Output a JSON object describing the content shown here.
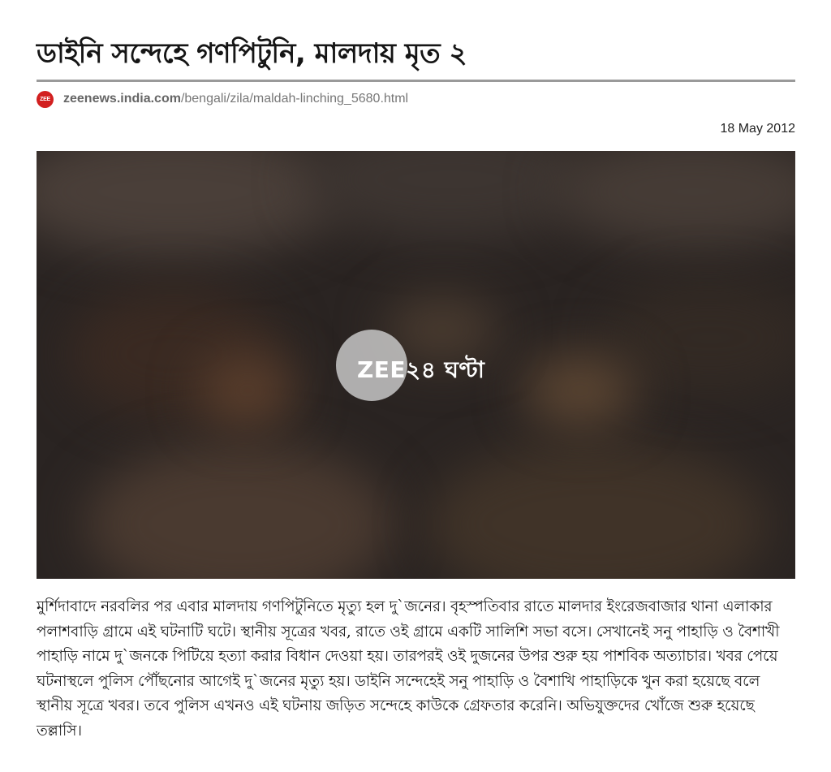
{
  "article": {
    "headline": "ডাইনি সন্দেহে গণপিটুনি, মালদায় মৃত ২",
    "source": {
      "favicon_text": "ZEE",
      "domain": "zeenews.india.com",
      "path": "/bengali/zila/maldah-linching_5680.html"
    },
    "date": "18 May 2012",
    "media": {
      "logo_text": "ZEE২৪ ঘণ্টা",
      "colors": {
        "background": "#2a2422",
        "logo_circle": "#cdcdcd"
      }
    },
    "body": "মুর্শিদাবাদে নরবলির পর এবার মালদায় গণপিটুনিতে মৃত্যু হল দু`জনের। বৃহস্পতিবার রাতে মালদার ইংরেজবাজার থানা এলাকার পলাশবাড়ি গ্রামে এই ঘটনাটি ঘটে। স্থানীয় সূত্রের খবর, রাতে ওই গ্রামে একটি সালিশি সভা বসে। সেখানেই সনু পাহাড়ি ও বৈশাখী পাহাড়ি নামে দু`জনকে পিটিয়ে হত্যা করার বিধান দেওয়া হয়। তারপরই ওই দুজনের উপর শুরু হয় পাশবিক অত্যাচার। খবর পেয়ে ঘটনাস্থলে পুলিস পৌঁছনোর আগেই দু`জনের মৃত্যু হয়। ডাইনি সন্দেহেই সনু পাহাড়ি ও বৈশাখি পাহাড়িকে খুন করা হয়েছে বলে স্থানীয় সূত্রে খবর। তবে পুলিস এখনও এই ঘটনায় জড়িত সন্দেহে কাউকে গ্রেফতার করেনি। অভিযুক্তদের খোঁজে শুরু হয়েছে তল্লাসি।"
  }
}
